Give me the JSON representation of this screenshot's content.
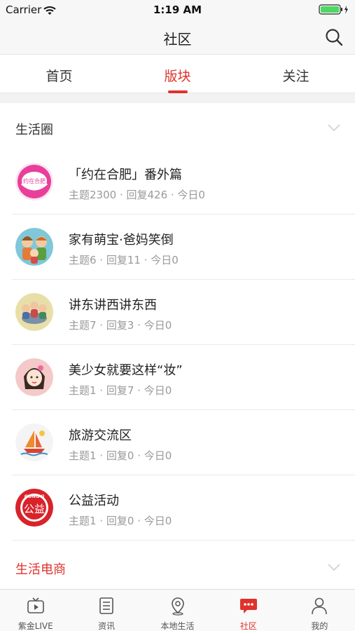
{
  "status_bar": {
    "carrier": "Carrier",
    "time": "1:19 AM"
  },
  "navbar": {
    "title": "社区",
    "search_icon": "search-icon"
  },
  "tabs": [
    {
      "label": "首页",
      "active": false
    },
    {
      "label": "版块",
      "active": true
    },
    {
      "label": "关注",
      "active": false
    }
  ],
  "sections": [
    {
      "title": "生活圈",
      "expanded": true
    },
    {
      "title": "生活电商",
      "expanded": false
    }
  ],
  "forums": [
    {
      "name": "「约在合肥」番外篇",
      "stats": "主题2300 · 回复426 · 今日0",
      "avatar_text": "约在合肥",
      "avatar_color": "#e8409a"
    },
    {
      "name": "家有萌宝·爸妈笑倒",
      "stats": "主题6 · 回复11 · 今日0",
      "avatar_color": "#7fc7d9"
    },
    {
      "name": "讲东讲西讲东西",
      "stats": "主题7 · 回复3 · 今日0",
      "avatar_color": "#e8dfa8"
    },
    {
      "name": "美少女就要这样“妆”",
      "stats": "主题1 · 回复7 · 今日0",
      "avatar_color": "#f5c9c9"
    },
    {
      "name": "旅游交流区",
      "stats": "主题1 · 回复0 · 今日0",
      "avatar_color": "#f4f4f4"
    },
    {
      "name": "公益活动",
      "stats": "主题1 · 回复0 · 今日0",
      "avatar_text": "GONGYI",
      "avatar_text_2": "公益",
      "avatar_color": "#d8232a"
    }
  ],
  "tabbar": [
    {
      "label": "紫金LIVE",
      "icon": "tv-icon",
      "active": false
    },
    {
      "label": "资讯",
      "icon": "news-icon",
      "active": false
    },
    {
      "label": "本地生活",
      "icon": "location-icon",
      "active": false
    },
    {
      "label": "社区",
      "icon": "chat-icon",
      "active": true
    },
    {
      "label": "我的",
      "icon": "person-icon",
      "active": false
    }
  ],
  "colors": {
    "accent": "#e0322b",
    "subtext": "#9a9a9a"
  }
}
